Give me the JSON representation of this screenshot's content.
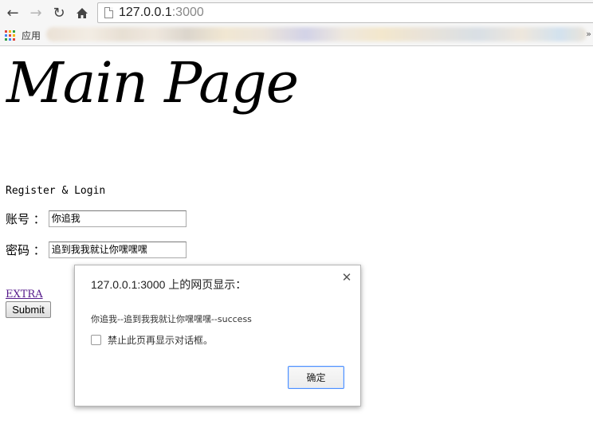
{
  "browser": {
    "url_host": "127.0.0.1",
    "url_port": ":3000",
    "bookmarks_apps_label": "应用",
    "bookmarks_overflow": "»"
  },
  "page": {
    "title": "Main Page",
    "section_label": "Register & Login",
    "account_label": "账号 ：",
    "account_value": "你追我",
    "password_label": "密码 ：",
    "password_value": "追到我我就让你嘿嘿嘿",
    "extra_link": "EXTRA",
    "submit_label": "Submit",
    "link_color": "#551a8b"
  },
  "dialog": {
    "title": "127.0.0.1:3000 上的网页显示：",
    "message": "你追我--追到我我就让你嘿嘿嘿--success",
    "checkbox_label": "禁止此页再显示对话框。",
    "checkbox_checked": false,
    "ok_label": "确定",
    "close_icon": "close-icon",
    "accent_color": "#4d90fe"
  }
}
